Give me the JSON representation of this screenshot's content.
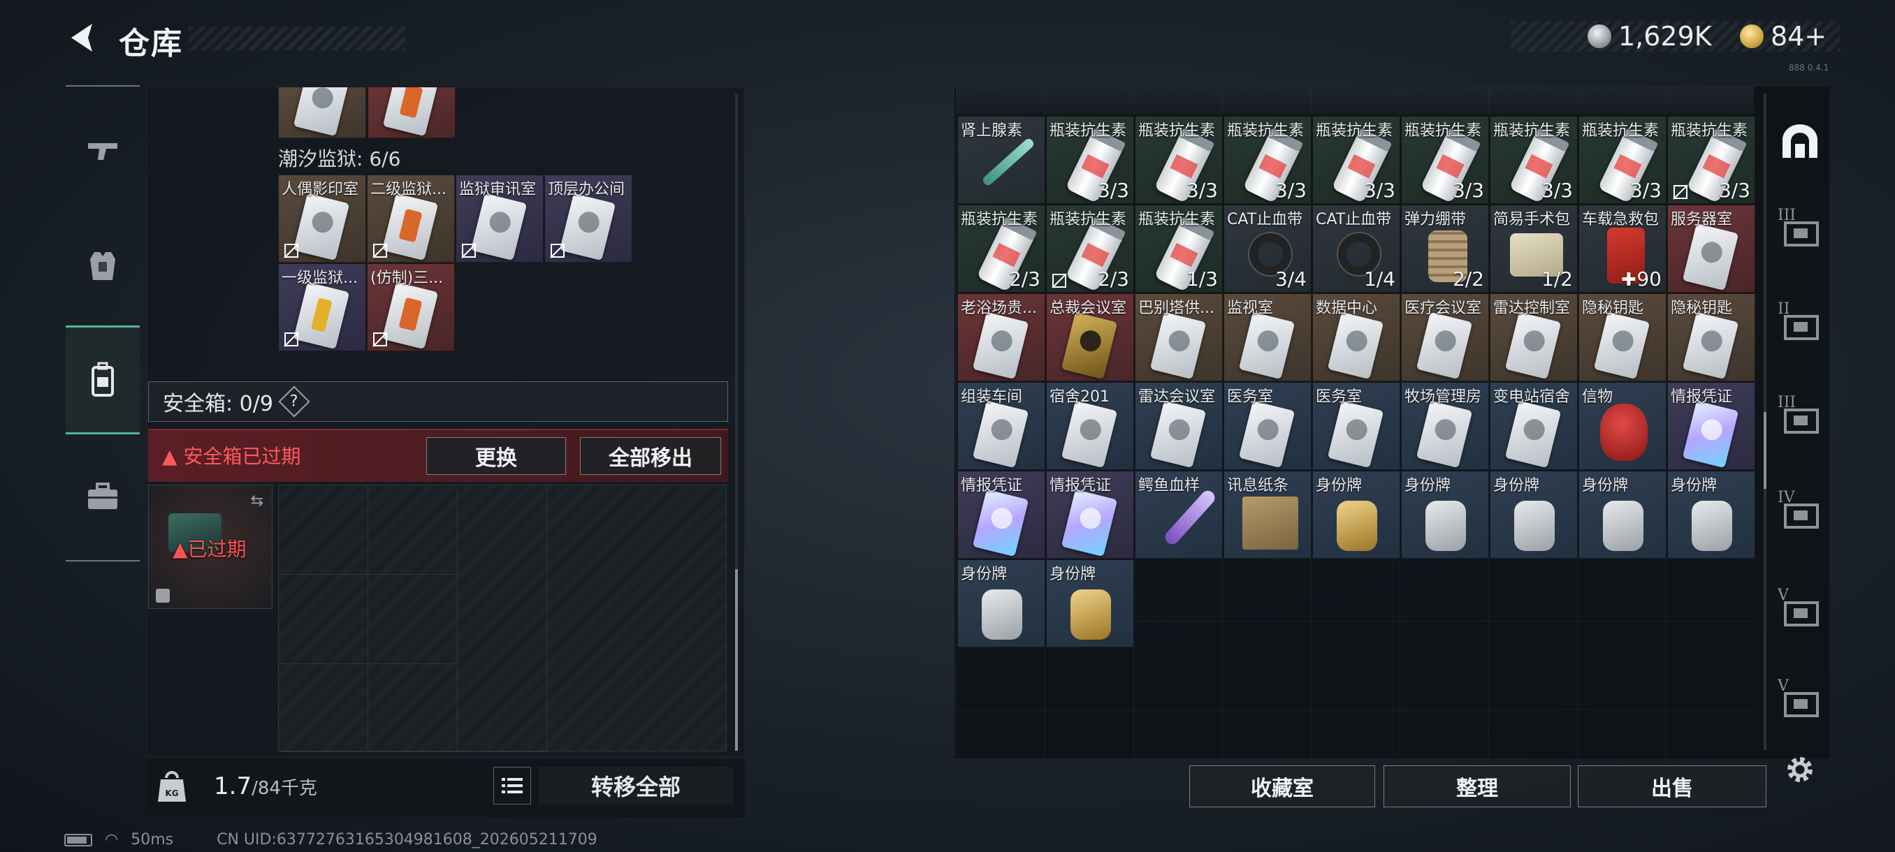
{
  "header": {
    "title": "仓库",
    "silver": "1,629K",
    "gold": "84+"
  },
  "left": {
    "prison_label": "潮汐监狱: 6/6",
    "prison_items": [
      {
        "label": "人偶影印室",
        "color": "brown"
      },
      {
        "label": "二级监狱...",
        "color": "brown"
      },
      {
        "label": "监狱审讯室",
        "color": "purple"
      },
      {
        "label": "顶层办公间",
        "color": "purple"
      },
      {
        "label": "一级监狱...",
        "color": "purple"
      },
      {
        "label": "(仿制)三...",
        "color": "red"
      }
    ],
    "safe_label": "安全箱: 0/9",
    "safe_help": "?",
    "safe_expired": "安全箱已过期",
    "replace_btn": "更换",
    "remove_all_btn": "全部移出",
    "expired_badge": "已过期",
    "weight": "1.7",
    "weight_max": "/84千克",
    "transfer_all_btn": "转移全部"
  },
  "right": {
    "items": [
      {
        "label": "肾上腺素",
        "count": "",
        "icon": "syringe",
        "color": "gray"
      },
      {
        "label": "瓶装抗生素",
        "count": "3/3",
        "icon": "bottle",
        "color": "green"
      },
      {
        "label": "瓶装抗生素",
        "count": "3/3",
        "icon": "bottle",
        "color": "green"
      },
      {
        "label": "瓶装抗生素",
        "count": "3/3",
        "icon": "bottle",
        "color": "green"
      },
      {
        "label": "瓶装抗生素",
        "count": "3/3",
        "icon": "bottle",
        "color": "green"
      },
      {
        "label": "瓶装抗生素",
        "count": "3/3",
        "icon": "bottle",
        "color": "green"
      },
      {
        "label": "瓶装抗生素",
        "count": "3/3",
        "icon": "bottle",
        "color": "green"
      },
      {
        "label": "瓶装抗生素",
        "count": "3/3",
        "icon": "bottle",
        "color": "green"
      },
      {
        "label": "瓶装抗生素",
        "count": "3/3",
        "icon": "bottle",
        "color": "green"
      },
      {
        "label": "瓶装抗生素",
        "count": "2/3",
        "icon": "bottle",
        "color": "green"
      },
      {
        "label": "瓶装抗生素",
        "count": "2/3",
        "icon": "bottle",
        "color": "green"
      },
      {
        "label": "瓶装抗生素",
        "count": "1/3",
        "icon": "bottle",
        "color": "green"
      },
      {
        "label": "CAT止血带",
        "count": "3/4",
        "icon": "tourniquet",
        "color": "gray"
      },
      {
        "label": "CAT止血带",
        "count": "1/4",
        "icon": "tourniquet",
        "color": "gray"
      },
      {
        "label": "弹力绷带",
        "count": "2/2",
        "icon": "bandage",
        "color": "gray"
      },
      {
        "label": "简易手术包",
        "count": "1/2",
        "icon": "pouch",
        "color": "gray"
      },
      {
        "label": "车载急救包",
        "count": "90",
        "icon": "kit",
        "color": "gray"
      },
      {
        "label": "服务器室",
        "count": "",
        "icon": "card",
        "color": "red"
      },
      {
        "label": "老浴场贵...",
        "count": "",
        "icon": "card",
        "color": "red"
      },
      {
        "label": "总裁会议室",
        "count": "",
        "icon": "card-gold",
        "color": "red"
      },
      {
        "label": "巴别塔供...",
        "count": "",
        "icon": "card",
        "color": "brown"
      },
      {
        "label": "监视室",
        "count": "",
        "icon": "card",
        "color": "brown"
      },
      {
        "label": "数据中心",
        "count": "",
        "icon": "card",
        "color": "brown"
      },
      {
        "label": "医疗会议室",
        "count": "",
        "icon": "card",
        "color": "brown"
      },
      {
        "label": "雷达控制室",
        "count": "",
        "icon": "card",
        "color": "brown"
      },
      {
        "label": "隐秘钥匙",
        "count": "",
        "icon": "card",
        "color": "brown"
      },
      {
        "label": "隐秘钥匙",
        "count": "",
        "icon": "card",
        "color": "brown"
      },
      {
        "label": "组装车间",
        "count": "",
        "icon": "card",
        "color": "blue"
      },
      {
        "label": "宿舍201",
        "count": "",
        "icon": "card",
        "color": "blue"
      },
      {
        "label": "雷达会议室",
        "count": "",
        "icon": "card",
        "color": "blue"
      },
      {
        "label": "医务室",
        "count": "",
        "icon": "card",
        "color": "blue"
      },
      {
        "label": "医务室",
        "count": "",
        "icon": "card",
        "color": "blue"
      },
      {
        "label": "牧场管理房",
        "count": "",
        "icon": "card",
        "color": "blue"
      },
      {
        "label": "变电站宿舍",
        "count": "",
        "icon": "card",
        "color": "blue"
      },
      {
        "label": "信物",
        "count": "",
        "icon": "mask",
        "color": "blue"
      },
      {
        "label": "情报凭证",
        "count": "",
        "icon": "card-holo",
        "color": "purple"
      },
      {
        "label": "情报凭证",
        "count": "",
        "icon": "card-holo",
        "color": "purple"
      },
      {
        "label": "情报凭证",
        "count": "",
        "icon": "card-holo",
        "color": "purple"
      },
      {
        "label": "鳄鱼血样",
        "count": "",
        "icon": "vial",
        "color": "blue"
      },
      {
        "label": "讯息纸条",
        "count": "",
        "icon": "paper",
        "color": "blue"
      },
      {
        "label": "身份牌",
        "count": "",
        "icon": "tag-gold",
        "color": "blue"
      },
      {
        "label": "身份牌",
        "count": "",
        "icon": "tag",
        "color": "blue"
      },
      {
        "label": "身份牌",
        "count": "",
        "icon": "tag",
        "color": "blue"
      },
      {
        "label": "身份牌",
        "count": "",
        "icon": "tag",
        "color": "blue"
      },
      {
        "label": "身份牌",
        "count": "",
        "icon": "tag",
        "color": "blue"
      },
      {
        "label": "身份牌",
        "count": "",
        "icon": "tag",
        "color": "blue"
      },
      {
        "label": "身份牌",
        "count": "",
        "icon": "tag-gold",
        "color": "blue"
      }
    ],
    "collection_btn": "收藏室",
    "sort_btn": "整理",
    "sell_btn": "出售"
  },
  "side_tabs": [
    "III",
    "II",
    "III",
    "IV",
    "V",
    "V"
  ],
  "status": {
    "ping": "50ms",
    "uid": "CN UID:63772763165304981608_202605211709"
  },
  "version": "888 0.4.1"
}
